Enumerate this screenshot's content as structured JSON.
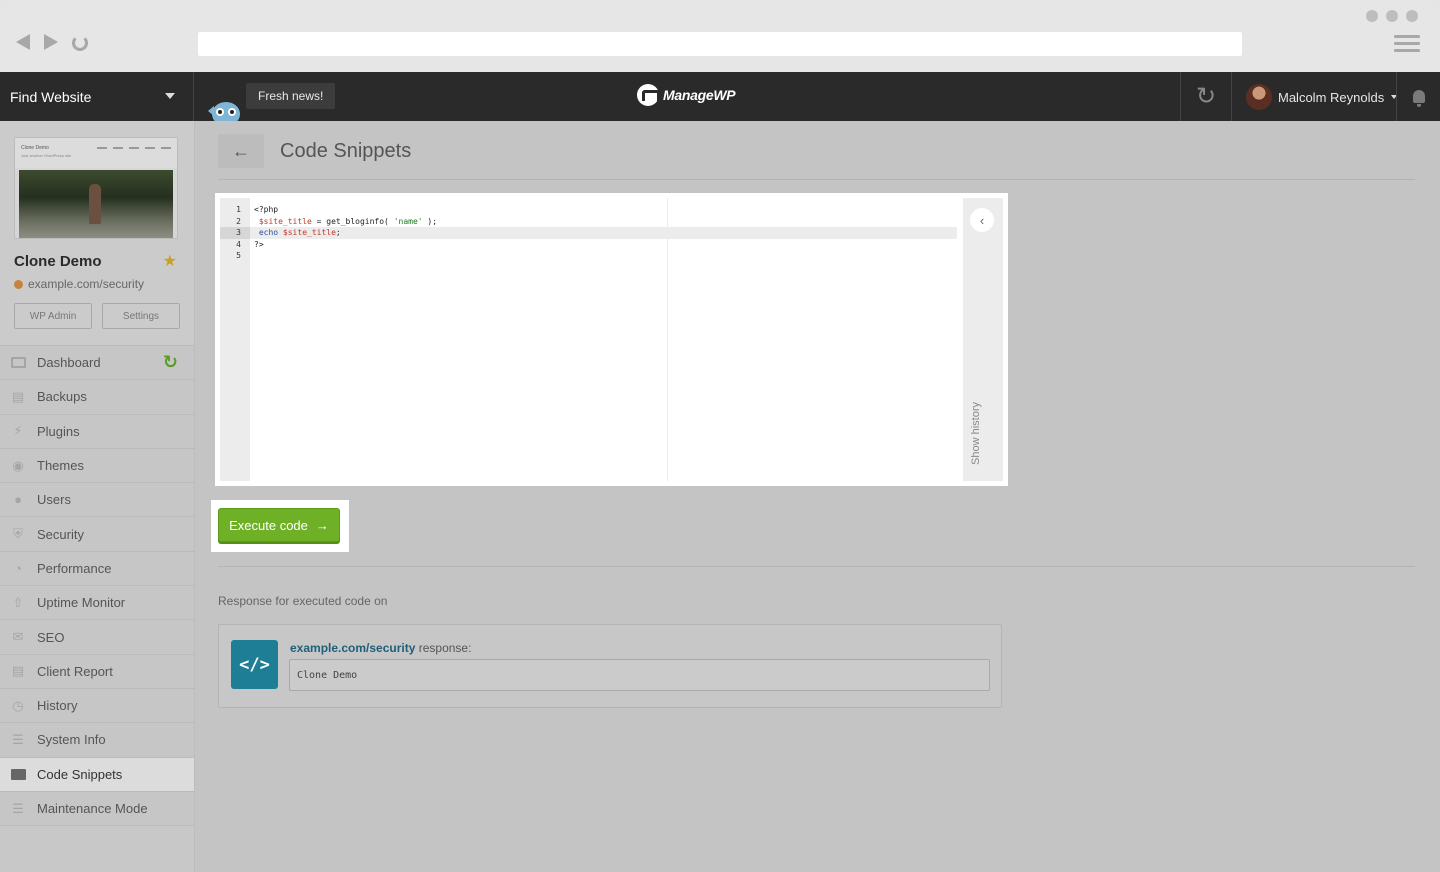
{
  "header": {
    "site_picker_label": "Find Website",
    "news_label": "Fresh news!",
    "logo_text": "ManageWP",
    "user_name": "Malcolm Reynolds"
  },
  "site": {
    "name": "Clone Demo",
    "url": "example.com/security",
    "wp_admin_label": "WP Admin",
    "settings_label": "Settings",
    "thumbnail_title": "Clone Demo",
    "thumbnail_subtitle": "Just another WordPress site",
    "status_color": "#c5843c"
  },
  "sidebar": {
    "items": [
      {
        "label": "Dashboard",
        "icon": "monitor-icon"
      },
      {
        "label": "Backups",
        "icon": "backup-icon"
      },
      {
        "label": "Plugins",
        "icon": "plug-icon"
      },
      {
        "label": "Themes",
        "icon": "palette-icon"
      },
      {
        "label": "Users",
        "icon": "user-icon"
      },
      {
        "label": "Security",
        "icon": "shield-icon"
      },
      {
        "label": "Performance",
        "icon": "gauge-icon"
      },
      {
        "label": "Uptime Monitor",
        "icon": "arrow-up-icon"
      },
      {
        "label": "SEO",
        "icon": "megaphone-icon"
      },
      {
        "label": "Client Report",
        "icon": "chart-icon"
      },
      {
        "label": "History",
        "icon": "clock-icon"
      },
      {
        "label": "System Info",
        "icon": "list-icon"
      },
      {
        "label": "Code Snippets",
        "icon": "terminal-icon",
        "active": true
      },
      {
        "label": "Maintenance Mode",
        "icon": "barrier-icon"
      }
    ]
  },
  "main": {
    "title": "Code Snippets",
    "editor": {
      "line_numbers": [
        "1",
        "2",
        "3",
        "4",
        "5"
      ],
      "lines": [
        "<?php",
        " $site_title = get_bloginfo( 'name' );",
        " echo $site_title;",
        "?>",
        ""
      ],
      "current_line": 3,
      "history_label": "Show history"
    },
    "execute_label": "Execute code",
    "response_heading": "Response for executed code on",
    "response": {
      "site_url": "example.com/security",
      "suffix": " response:",
      "output": "Clone Demo"
    }
  },
  "colors": {
    "accent_green": "#6fb126",
    "code_icon_bg": "#1d7e96",
    "header_bg": "#2a2a2a"
  }
}
